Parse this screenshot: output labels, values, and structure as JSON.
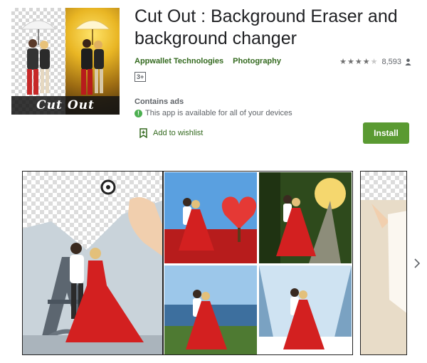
{
  "app": {
    "title": "Cut Out : Background Eraser and background changer",
    "developer": "Appwallet Technologies",
    "category": "Photography",
    "rating_count": "8,593",
    "rating_stars": 4,
    "age_rating": "3+",
    "contains_ads": "Contains ads",
    "availability": "This app is available for all of your devices",
    "wishlist_label": "Add to wishlist",
    "install_label": "Install",
    "icon_banner": "Cut Out"
  },
  "colors": {
    "accent_green": "#33691e",
    "install_green": "#5a9a32",
    "info_green": "#4caf50"
  },
  "icons": [
    "star-icon",
    "person-icon",
    "info-icon",
    "bookmark-add-icon",
    "chevron-right-icon"
  ]
}
